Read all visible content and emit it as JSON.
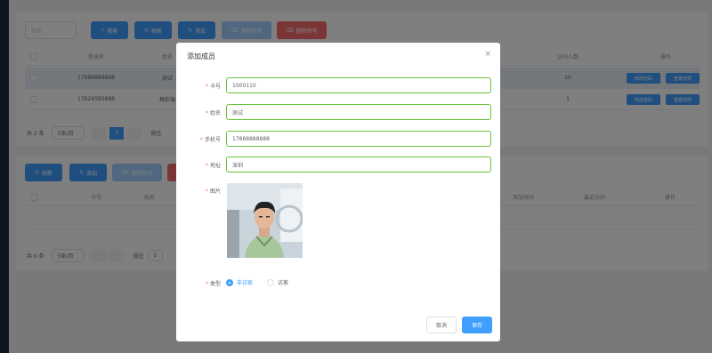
{
  "toolbar1": {
    "search_placeholder": "姓名",
    "search_label": "搜索",
    "refresh_label": "刷新",
    "add_label": "添加",
    "batch_delete_label": "删除所有",
    "delete_all_label": "删除所有"
  },
  "table1": {
    "headers": [
      "登录名",
      "姓名",
      "访问人数",
      "操作"
    ],
    "rows": [
      {
        "login": "17888888888",
        "name": "测试",
        "visits": "10",
        "edit": "修改密码",
        "perm": "重置权限"
      },
      {
        "login": "17629585888",
        "name": "梅彩瑞",
        "visits": "1",
        "edit": "修改密码",
        "perm": "重置权限"
      }
    ],
    "total": "共 2 条",
    "page_size": "5条/页",
    "page": "1",
    "goto": "前往"
  },
  "toolbar2": {
    "refresh_label": "刷新",
    "add_label": "添加",
    "batch_delete_label": "删除所有"
  },
  "table2": {
    "headers": [
      "卡号",
      "姓名",
      "添加时间",
      "最近访问",
      "操作"
    ],
    "total": "共 0 条",
    "page_size": "5条/页",
    "goto": "前往",
    "page": "1"
  },
  "modal": {
    "title": "添加成员",
    "close": "×",
    "fields": {
      "card_label": "卡号",
      "card_value": "1000110",
      "name_label": "姓名",
      "name_value": "测试",
      "phone_label": "手机号",
      "phone_value": "17888888888",
      "addr_label": "地址",
      "addr_value": "深圳",
      "photo_label": "图片",
      "type_label": "类型",
      "type_opt1": "非访客",
      "type_opt2": "访客"
    },
    "cancel_label": "取消",
    "save_label": "保存"
  },
  "colors": {
    "primary": "#409eff",
    "danger": "#f56c6c",
    "success_border": "#67c23a"
  },
  "icons": [
    "search-icon",
    "refresh-icon",
    "edit-icon",
    "delete-icon",
    "close-icon"
  ]
}
